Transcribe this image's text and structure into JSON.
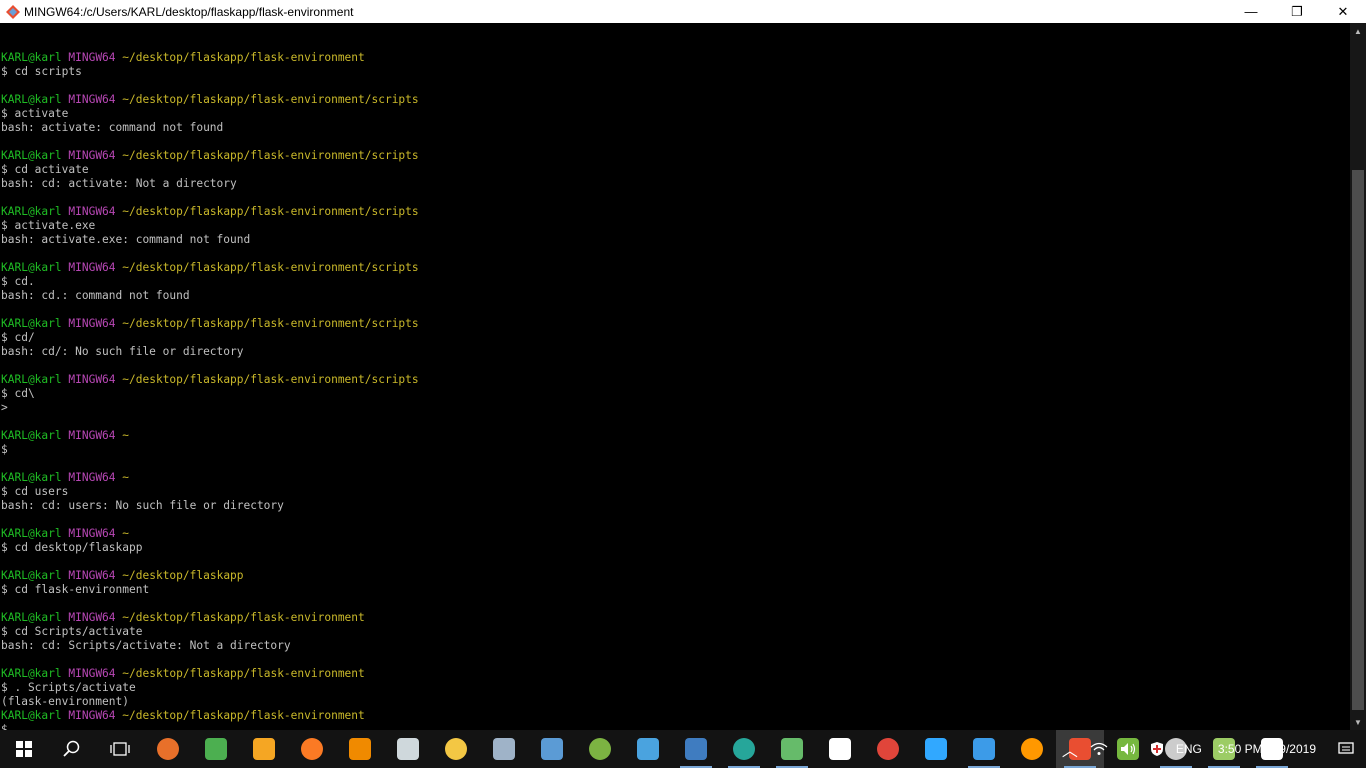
{
  "window": {
    "title": "MINGW64:/c/Users/KARL/desktop/flaskapp/flask-environment",
    "min_glyph": "—",
    "max_glyph": "❐",
    "close_glyph": "✕"
  },
  "colors": {
    "user": "#1fbd24",
    "host": "#b847b5",
    "path": "#c9b82a",
    "text": "#c0c0c0"
  },
  "prompt": {
    "user": "KARL@karl",
    "host": "MINGW64"
  },
  "terminal_lines": [
    {
      "t": "blank",
      "text": ""
    },
    {
      "t": "prompt",
      "path": "~/desktop/flaskapp/flask-environment"
    },
    {
      "t": "out",
      "text": "$ cd scripts"
    },
    {
      "t": "blank",
      "text": ""
    },
    {
      "t": "prompt",
      "path": "~/desktop/flaskapp/flask-environment/scripts"
    },
    {
      "t": "out",
      "text": "$ activate"
    },
    {
      "t": "out",
      "text": "bash: activate: command not found"
    },
    {
      "t": "blank",
      "text": ""
    },
    {
      "t": "prompt",
      "path": "~/desktop/flaskapp/flask-environment/scripts"
    },
    {
      "t": "out",
      "text": "$ cd activate"
    },
    {
      "t": "out",
      "text": "bash: cd: activate: Not a directory"
    },
    {
      "t": "blank",
      "text": ""
    },
    {
      "t": "prompt",
      "path": "~/desktop/flaskapp/flask-environment/scripts"
    },
    {
      "t": "out",
      "text": "$ activate.exe"
    },
    {
      "t": "out",
      "text": "bash: activate.exe: command not found"
    },
    {
      "t": "blank",
      "text": ""
    },
    {
      "t": "prompt",
      "path": "~/desktop/flaskapp/flask-environment/scripts"
    },
    {
      "t": "out",
      "text": "$ cd."
    },
    {
      "t": "out",
      "text": "bash: cd.: command not found"
    },
    {
      "t": "blank",
      "text": ""
    },
    {
      "t": "prompt",
      "path": "~/desktop/flaskapp/flask-environment/scripts"
    },
    {
      "t": "out",
      "text": "$ cd/"
    },
    {
      "t": "out",
      "text": "bash: cd/: No such file or directory"
    },
    {
      "t": "blank",
      "text": ""
    },
    {
      "t": "prompt",
      "path": "~/desktop/flaskapp/flask-environment/scripts"
    },
    {
      "t": "out",
      "text": "$ cd\\"
    },
    {
      "t": "out",
      "text": ">"
    },
    {
      "t": "blank",
      "text": ""
    },
    {
      "t": "prompt",
      "path": "~"
    },
    {
      "t": "out",
      "text": "$"
    },
    {
      "t": "blank",
      "text": ""
    },
    {
      "t": "prompt",
      "path": "~"
    },
    {
      "t": "out",
      "text": "$ cd users"
    },
    {
      "t": "out",
      "text": "bash: cd: users: No such file or directory"
    },
    {
      "t": "blank",
      "text": ""
    },
    {
      "t": "prompt",
      "path": "~"
    },
    {
      "t": "out",
      "text": "$ cd desktop/flaskapp"
    },
    {
      "t": "blank",
      "text": ""
    },
    {
      "t": "prompt",
      "path": "~/desktop/flaskapp"
    },
    {
      "t": "out",
      "text": "$ cd flask-environment"
    },
    {
      "t": "blank",
      "text": ""
    },
    {
      "t": "prompt",
      "path": "~/desktop/flaskapp/flask-environment"
    },
    {
      "t": "out",
      "text": "$ cd Scripts/activate"
    },
    {
      "t": "out",
      "text": "bash: cd: Scripts/activate: Not a directory"
    },
    {
      "t": "blank",
      "text": ""
    },
    {
      "t": "prompt",
      "path": "~/desktop/flaskapp/flask-environment"
    },
    {
      "t": "out",
      "text": "$ . Scripts/activate"
    },
    {
      "t": "out",
      "text": "(flask-environment)"
    },
    {
      "t": "prompt",
      "path": "~/desktop/flaskapp/flask-environment"
    },
    {
      "t": "out",
      "text": "$"
    }
  ],
  "taskbar": {
    "apps": [
      {
        "name": "firefox-icon",
        "color": "#e8702a",
        "open": false
      },
      {
        "name": "cloud-drive-icon",
        "color": "#4caf50",
        "open": false
      },
      {
        "name": "media-player-icon",
        "color": "#f5a623",
        "open": false
      },
      {
        "name": "xampp-icon",
        "color": "#fb7a24",
        "open": false
      },
      {
        "name": "vlc-icon",
        "color": "#f08a00",
        "open": false
      },
      {
        "name": "scanner-icon",
        "color": "#cfd8dc",
        "open": false
      },
      {
        "name": "file-explorer-icon",
        "color": "#f3c744",
        "open": false
      },
      {
        "name": "system-settings-icon",
        "color": "#9fb3c8",
        "open": false
      },
      {
        "name": "virtualbox-icon",
        "color": "#5b9bd5",
        "open": false
      },
      {
        "name": "android-studio-icon",
        "color": "#7cb342",
        "open": false
      },
      {
        "name": "image-viewer-icon",
        "color": "#4aa3df",
        "open": false
      },
      {
        "name": "python-icon",
        "color": "#3f7cc0",
        "open": true
      },
      {
        "name": "editor-icon",
        "color": "#26a69a",
        "open": true
      },
      {
        "name": "notepad-icon",
        "color": "#66bb6a",
        "open": true
      },
      {
        "name": "settings-gear-icon",
        "color": "#ffffff",
        "open": false
      },
      {
        "name": "chrome-icon",
        "color": "#e0453a",
        "open": false
      },
      {
        "name": "photoshop-icon",
        "color": "#31a8ff",
        "open": false
      },
      {
        "name": "vscode-icon",
        "color": "#3c9be8",
        "open": true
      },
      {
        "name": "weibo-icon",
        "color": "#ff9800",
        "open": false
      },
      {
        "name": "git-bash-icon",
        "color": "#e94e31",
        "open": true,
        "active": true
      },
      {
        "name": "utorrent-icon",
        "color": "#76b83f",
        "open": false
      },
      {
        "name": "cmd-icon",
        "color": "#cccccc",
        "open": true
      },
      {
        "name": "notepad-plus-icon",
        "color": "#9ccc65",
        "open": true
      },
      {
        "name": "photos-icon",
        "color": "#ffffff",
        "open": true
      }
    ],
    "lang": "ENG",
    "time": "3:50 PM",
    "date": "4/29/2019"
  }
}
